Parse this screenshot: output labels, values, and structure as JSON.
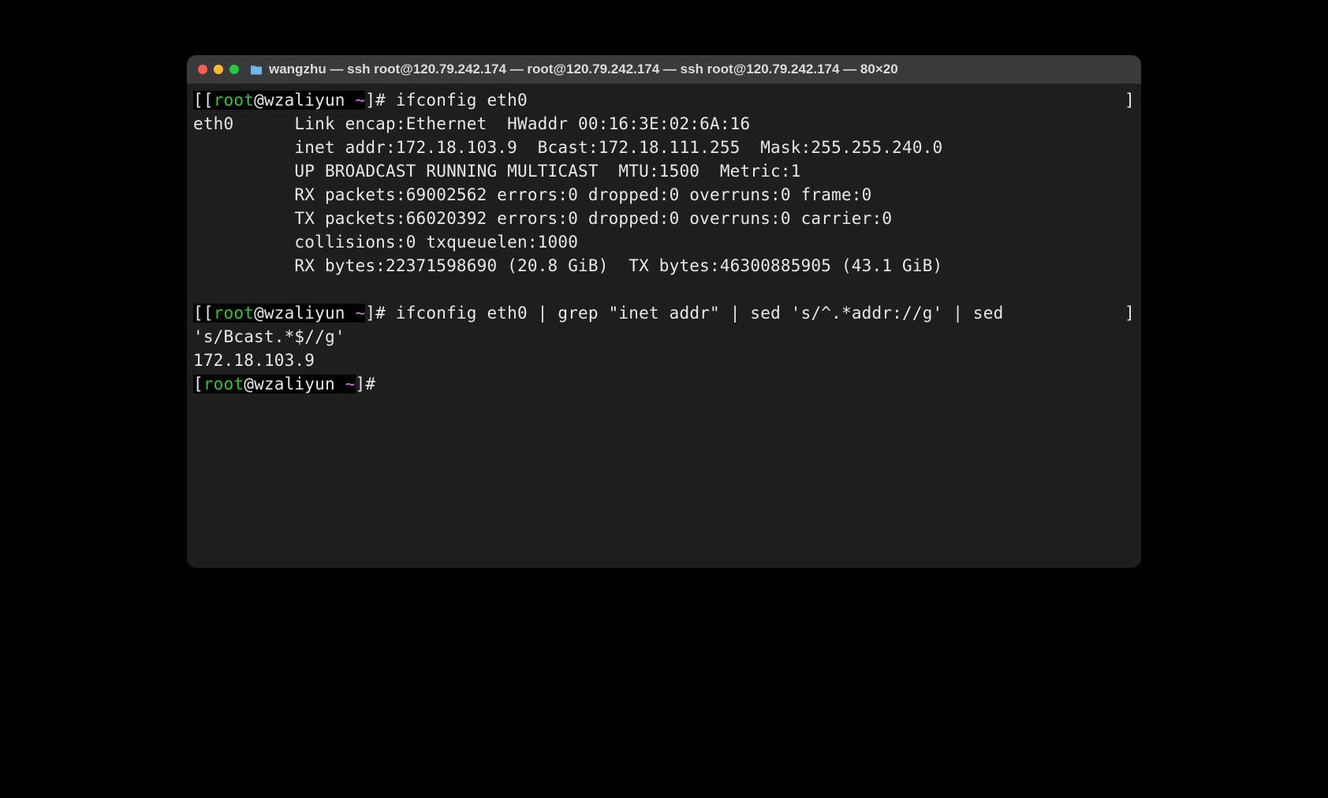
{
  "window": {
    "title": "wangzhu — ssh root@120.79.242.174 — root@120.79.242.174 — ssh root@120.79.242.174 — 80×20"
  },
  "prompt": {
    "user": "root",
    "at": "@",
    "host": "wzaliyun",
    "tilde": "~",
    "open": "[",
    "double_open": "[[",
    "close": "]#",
    "close_space": " "
  },
  "cmd1": "ifconfig eth0",
  "out1_l1": "eth0      Link encap:Ethernet  HWaddr 00:16:3E:02:6A:16",
  "out1_l2": "          inet addr:172.18.103.9  Bcast:172.18.111.255  Mask:255.255.240.0",
  "out1_l3": "          UP BROADCAST RUNNING MULTICAST  MTU:1500  Metric:1",
  "out1_l4": "          RX packets:69002562 errors:0 dropped:0 overruns:0 frame:0",
  "out1_l5": "          TX packets:66020392 errors:0 dropped:0 overruns:0 carrier:0",
  "out1_l6": "          collisions:0 txqueuelen:1000",
  "out1_l7": "          RX bytes:22371598690 (20.8 GiB)  TX bytes:46300885905 (43.1 GiB)",
  "cmd2_a": "ifconfig eth0 | grep \"inet addr\" | sed 's/^.*addr://g' | sed ",
  "cmd2_b": "'s/Bcast.*$//g'",
  "out2": "172.18.103.9",
  "right_bracket": "]"
}
